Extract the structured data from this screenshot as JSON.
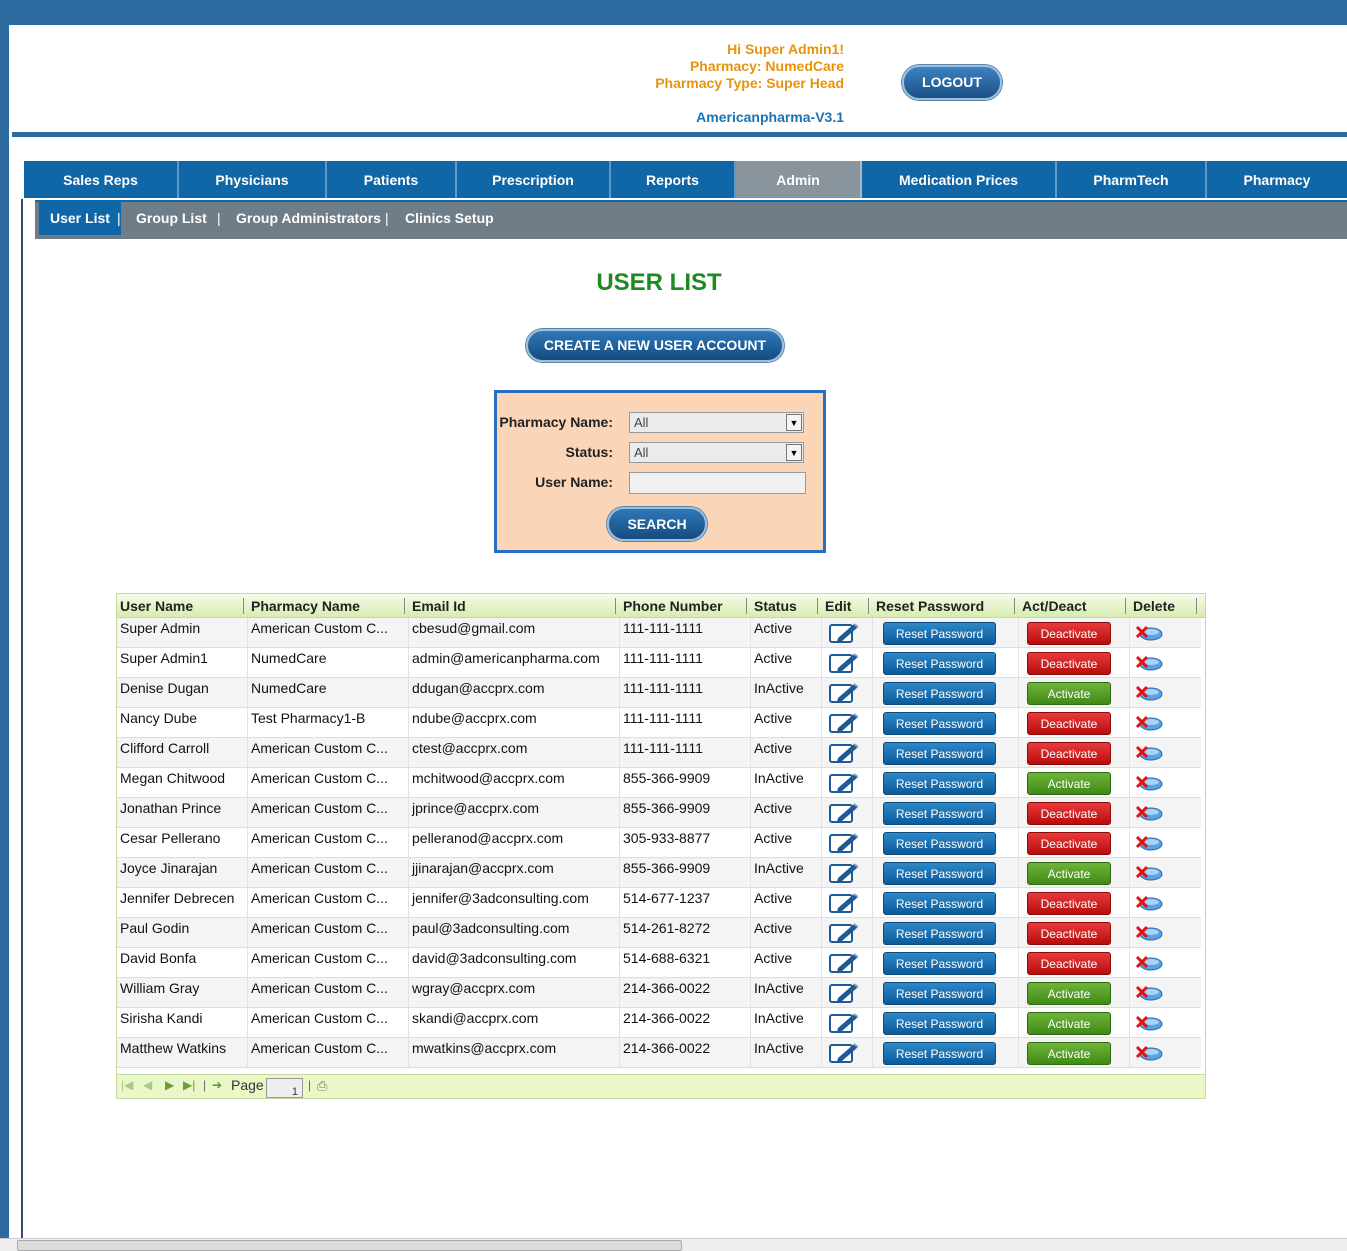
{
  "header": {
    "greeting": "Hi Super Admin1!",
    "pharmacy": "Pharmacy: NumedCare",
    "pharmacy_type": "Pharmacy Type: Super Head",
    "version": "Americanpharma-V3.1",
    "logout_label": "LOGOUT"
  },
  "nav": {
    "tabs": [
      "Sales Reps",
      "Physicians",
      "Patients",
      "Prescription",
      "Reports",
      "Admin",
      "Medication Prices",
      "PharmTech",
      "Pharmacy"
    ],
    "active": "Admin"
  },
  "subnav": {
    "items": [
      "User List",
      "Group List",
      "Group Administrators",
      "Clinics Setup"
    ],
    "separator": "|",
    "active": "User List"
  },
  "page": {
    "title": "USER LIST",
    "create_label": "CREATE A NEW USER ACCOUNT"
  },
  "search": {
    "pharmacy_label": "Pharmacy Name:",
    "pharmacy_value": "All",
    "status_label": "Status:",
    "status_value": "All",
    "username_label": "User Name:",
    "username_value": "",
    "button_label": "SEARCH"
  },
  "grid": {
    "columns": [
      "User Name",
      "Pharmacy Name",
      "Email Id",
      "Phone Number",
      "Status",
      "Edit",
      "Reset Password",
      "Act/Deact",
      "Delete"
    ],
    "reset_label": "Reset Password",
    "rows": [
      {
        "name": "Super Admin",
        "pharmacy": "American Custom C...",
        "email": "cbesud@gmail.com",
        "phone": "111-111-1111",
        "status": "Active",
        "action": "Deactivate"
      },
      {
        "name": "Super Admin1",
        "pharmacy": "NumedCare",
        "email": "admin@americanpharma.com",
        "phone": "111-111-1111",
        "status": "Active",
        "action": "Deactivate"
      },
      {
        "name": "Denise Dugan",
        "pharmacy": "NumedCare",
        "email": "ddugan@accprx.com",
        "phone": "111-111-1111",
        "status": "InActive",
        "action": "Activate"
      },
      {
        "name": "Nancy Dube",
        "pharmacy": "Test Pharmacy1-B",
        "email": "ndube@accprx.com",
        "phone": "111-111-1111",
        "status": "Active",
        "action": "Deactivate"
      },
      {
        "name": "Clifford Carroll",
        "pharmacy": "American Custom C...",
        "email": "ctest@accprx.com",
        "phone": "111-111-1111",
        "status": "Active",
        "action": "Deactivate"
      },
      {
        "name": "Megan Chitwood",
        "pharmacy": "American Custom C...",
        "email": "mchitwood@accprx.com",
        "phone": "855-366-9909",
        "status": "InActive",
        "action": "Activate"
      },
      {
        "name": "Jonathan Prince",
        "pharmacy": "American Custom C...",
        "email": "jprince@accprx.com",
        "phone": "855-366-9909",
        "status": "Active",
        "action": "Deactivate"
      },
      {
        "name": "Cesar Pellerano",
        "pharmacy": "American Custom C...",
        "email": "pelleranod@accprx.com",
        "phone": "305-933-8877",
        "status": "Active",
        "action": "Deactivate"
      },
      {
        "name": "Joyce Jinarajan",
        "pharmacy": "American Custom C...",
        "email": "jjinarajan@accprx.com",
        "phone": "855-366-9909",
        "status": "InActive",
        "action": "Activate"
      },
      {
        "name": "Jennifer Debrecen",
        "pharmacy": "American Custom C...",
        "email": "jennifer@3adconsulting.com",
        "phone": "514-677-1237",
        "status": "Active",
        "action": "Deactivate"
      },
      {
        "name": "Paul Godin",
        "pharmacy": "American Custom C...",
        "email": "paul@3adconsulting.com",
        "phone": "514-261-8272",
        "status": "Active",
        "action": "Deactivate"
      },
      {
        "name": "David Bonfa",
        "pharmacy": "American Custom C...",
        "email": "david@3adconsulting.com",
        "phone": "514-688-6321",
        "status": "Active",
        "action": "Deactivate"
      },
      {
        "name": "William Gray",
        "pharmacy": "American Custom C...",
        "email": "wgray@accprx.com",
        "phone": "214-366-0022",
        "status": "InActive",
        "action": "Activate"
      },
      {
        "name": "Sirisha Kandi",
        "pharmacy": "American Custom C...",
        "email": "skandi@accprx.com",
        "phone": "214-366-0022",
        "status": "InActive",
        "action": "Activate"
      },
      {
        "name": "Matthew Watkins",
        "pharmacy": "American Custom C...",
        "email": "mwatkins@accprx.com",
        "phone": "214-366-0022",
        "status": "InActive",
        "action": "Activate"
      }
    ]
  },
  "pager": {
    "page_label": "Page",
    "page_value": "1"
  },
  "colors": {
    "brand": "#2c6aa0",
    "nav": "#0f67a8",
    "title": "#1f8a1f",
    "deactivate": "#c81b1b",
    "activate": "#4f9a22"
  }
}
